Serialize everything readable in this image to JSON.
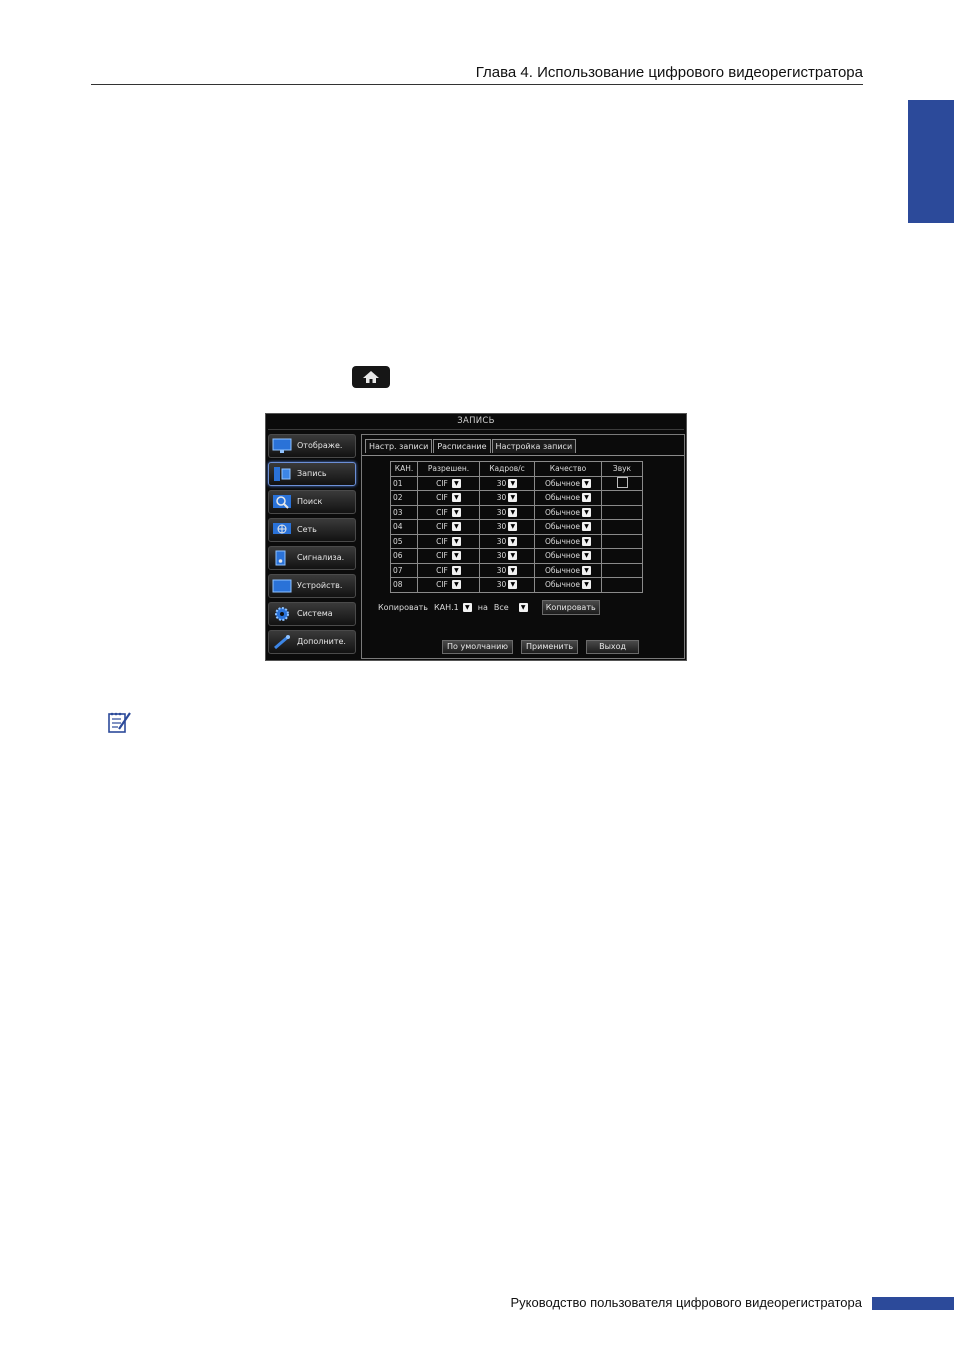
{
  "header": {
    "chapter_title": "Глава 4. Использование цифрового видеорегистратора"
  },
  "colors": {
    "accent": "#2c4a9a",
    "screen_bg": "#0b0b0b"
  },
  "home_button": {
    "icon": "home-icon"
  },
  "dvr": {
    "title": "ЗАПИСЬ",
    "menu": [
      {
        "label": "Отображе.",
        "icon": "monitor-icon",
        "active": false
      },
      {
        "label": "Запись",
        "icon": "record-icon",
        "active": true
      },
      {
        "label": "Поиск",
        "icon": "search-icon",
        "active": false
      },
      {
        "label": "Сеть",
        "icon": "network-icon",
        "active": false
      },
      {
        "label": "Сигнализа.",
        "icon": "alarm-icon",
        "active": false
      },
      {
        "label": "Устройств.",
        "icon": "device-icon",
        "active": false
      },
      {
        "label": "Система",
        "icon": "gear-icon",
        "active": false
      },
      {
        "label": "Дополните.",
        "icon": "tools-icon",
        "active": false
      }
    ],
    "tabs": [
      {
        "label": "Настр. записи",
        "active": false
      },
      {
        "label": "Расписание",
        "active": false
      },
      {
        "label": "Настройка записи",
        "active": true
      }
    ],
    "table": {
      "headers": [
        "КАН.",
        "Разрешен.",
        "Кадров/с",
        "Качество",
        "Звук"
      ],
      "rows": [
        {
          "ch": "01",
          "res": "CIF",
          "fps": "30",
          "quality": "Обычное",
          "audio_checkbox": true
        },
        {
          "ch": "02",
          "res": "CIF",
          "fps": "30",
          "quality": "Обычное",
          "audio_checkbox": false
        },
        {
          "ch": "03",
          "res": "CIF",
          "fps": "30",
          "quality": "Обычное",
          "audio_checkbox": false
        },
        {
          "ch": "04",
          "res": "CIF",
          "fps": "30",
          "quality": "Обычное",
          "audio_checkbox": false
        },
        {
          "ch": "05",
          "res": "CIF",
          "fps": "30",
          "quality": "Обычное",
          "audio_checkbox": false
        },
        {
          "ch": "06",
          "res": "CIF",
          "fps": "30",
          "quality": "Обычное",
          "audio_checkbox": false
        },
        {
          "ch": "07",
          "res": "CIF",
          "fps": "30",
          "quality": "Обычное",
          "audio_checkbox": false
        },
        {
          "ch": "08",
          "res": "CIF",
          "fps": "30",
          "quality": "Обычное",
          "audio_checkbox": false
        }
      ]
    },
    "copy": {
      "label": "Копировать",
      "from_value": "КАН.1",
      "to_label": "на",
      "to_value": "Все",
      "button": "Копировать"
    },
    "buttons": {
      "default": "По умолчанию",
      "apply": "Применить",
      "exit": "Выход"
    }
  },
  "footer": {
    "text": "Руководство пользователя цифрового видеорегистратора"
  }
}
